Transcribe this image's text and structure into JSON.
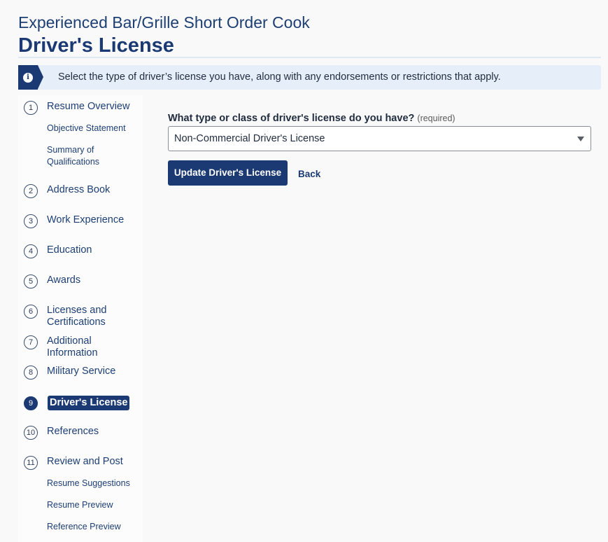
{
  "header": {
    "subtitle": "Experienced Bar/Grille Short Order Cook",
    "title": "Driver's License"
  },
  "info": {
    "icon": "info-icon",
    "text": "Select the type of driver’s license you have, along with any endorsements or restrictions that apply."
  },
  "sidebar": {
    "steps": [
      {
        "num": "1",
        "label": "Resume Overview"
      },
      {
        "num": "2",
        "label": "Address Book"
      },
      {
        "num": "3",
        "label": "Work Experience"
      },
      {
        "num": "4",
        "label": "Education"
      },
      {
        "num": "5",
        "label": "Awards"
      },
      {
        "num": "6",
        "label": "Licenses and Certifications"
      },
      {
        "num": "7",
        "label": "Additional Information"
      },
      {
        "num": "8",
        "label": "Military Service"
      },
      {
        "num": "9",
        "label": "Driver's License",
        "active": true
      },
      {
        "num": "10",
        "label": "References"
      },
      {
        "num": "11",
        "label": "Review and Post"
      }
    ],
    "substeps_overview": [
      "Objective Statement",
      "Summary of Qualifications"
    ],
    "substeps_review": [
      "Resume Suggestions",
      "Resume Preview",
      "Reference Preview"
    ]
  },
  "form": {
    "question": "What type or class of driver's license do you have?",
    "required_note": "(required)",
    "selected_value": "Non-Commercial Driver's License",
    "submit_label": "Update Driver's License",
    "back_label": "Back"
  },
  "colors": {
    "brand": "#1b3a73",
    "info_bg": "#e6eff9"
  }
}
